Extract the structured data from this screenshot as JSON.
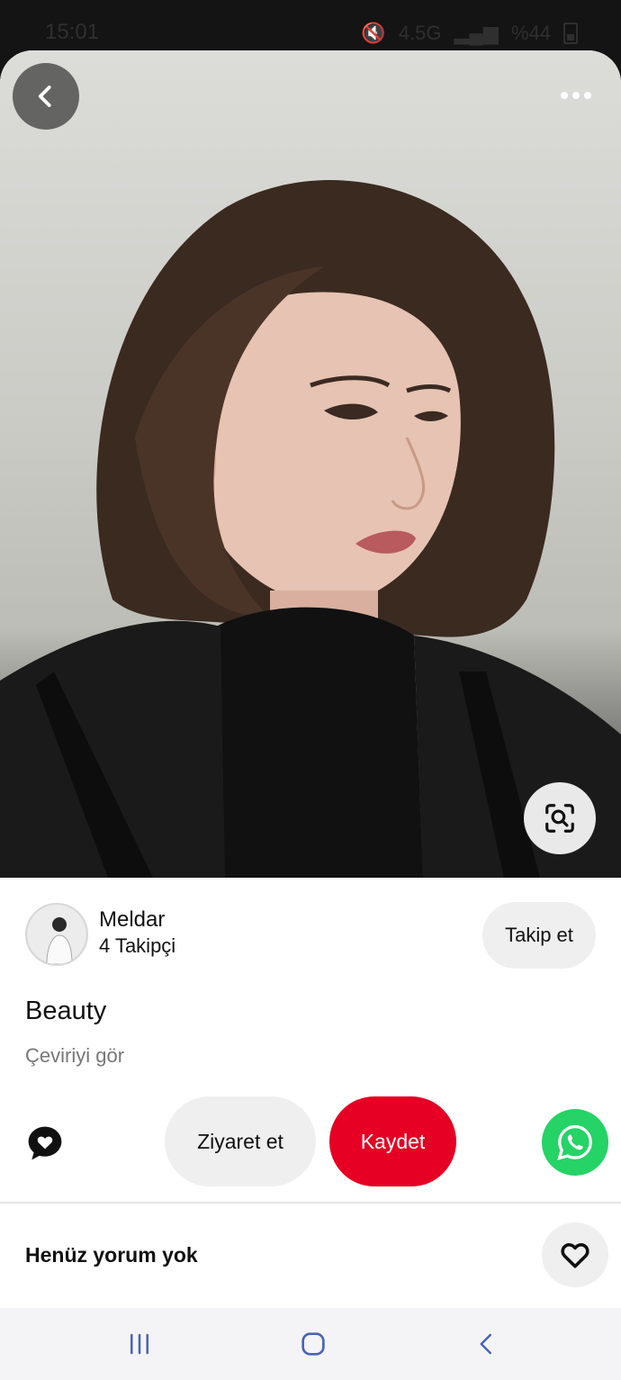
{
  "status_bar": {
    "time": "15:01",
    "network": "4.5G",
    "battery": "%44"
  },
  "pin": {
    "image_alt": "",
    "title": "Beauty",
    "translate_label": "Çeviriyi gör"
  },
  "author": {
    "name": "Meldar",
    "followers": "4 Takipçi",
    "follow_label": "Takip et"
  },
  "actions": {
    "visit_label": "Ziyaret et",
    "save_label": "Kaydet"
  },
  "comments": {
    "empty_label": "Henüz yorum yok"
  },
  "icons": {
    "back": "chevron-left-icon",
    "more": "more-dots-icon",
    "lens": "visual-search-icon",
    "comment": "comment-heart-icon",
    "share": "whatsapp-icon",
    "like": "heart-outline-icon",
    "nav_recent": "recent-apps-icon",
    "nav_home": "home-icon",
    "nav_back": "back-icon"
  },
  "colors": {
    "save": "#e60023",
    "whatsapp": "#25d366",
    "secondary_button": "#efefef"
  }
}
